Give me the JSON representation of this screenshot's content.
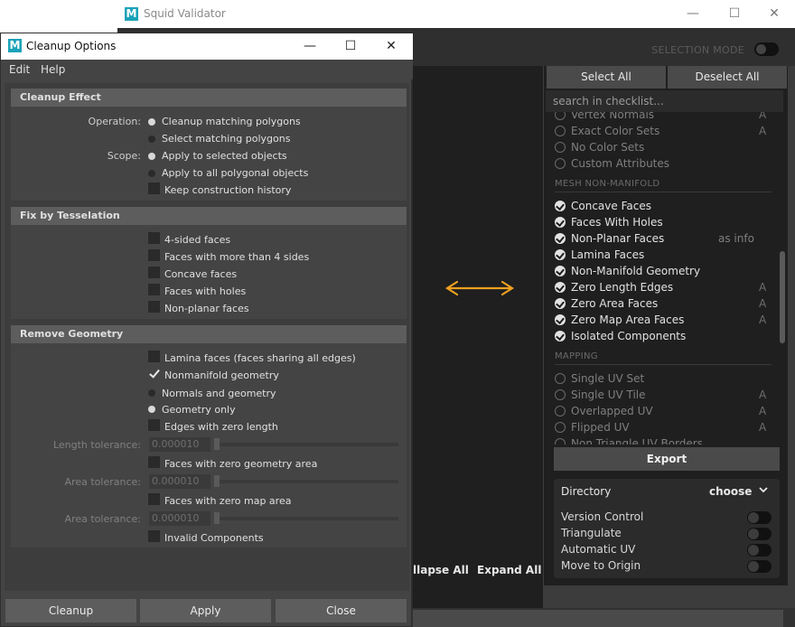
{
  "squid": {
    "title": "Squid Validator",
    "minimize": "—",
    "maximize": "☐",
    "close": "✕",
    "selection_mode": "SELECTION MODE",
    "select_all": "Select All",
    "deselect_all": "Deselect All",
    "search_placeholder": "search in checklist...",
    "collapse_all": "llapse All",
    "expand_all": "Expand All",
    "export": "Export",
    "directory_label": "Directory",
    "directory_value": "choose",
    "options": [
      "Version Control",
      "Triangulate",
      "Automatic UV",
      "Move to Origin"
    ],
    "arrow_color": "#f0a020",
    "sections": {
      "mesh_non_manifold": "MESH NON-MANIFOLD",
      "mapping": "MAPPING"
    },
    "items_top": [
      {
        "label": "Vertex Normals",
        "tag": "A",
        "on": false
      },
      {
        "label": "Exact Color Sets",
        "tag": "A",
        "on": false
      },
      {
        "label": "No Color Sets",
        "tag": "",
        "on": false
      },
      {
        "label": "Custom Attributes",
        "tag": "",
        "on": false
      }
    ],
    "items_manifold": [
      {
        "label": "Concave Faces",
        "tag": "",
        "on": true
      },
      {
        "label": "Faces With Holes",
        "tag": "",
        "on": true
      },
      {
        "label": "Non-Planar Faces",
        "tag": "",
        "info": "as info",
        "on": true
      },
      {
        "label": "Lamina Faces",
        "tag": "",
        "on": true
      },
      {
        "label": "Non-Manifold Geometry",
        "tag": "",
        "on": true
      },
      {
        "label": "Zero Length Edges",
        "tag": "A",
        "on": true
      },
      {
        "label": "Zero Area Faces",
        "tag": "A",
        "on": true
      },
      {
        "label": "Zero Map Area Faces",
        "tag": "A",
        "on": true
      },
      {
        "label": "Isolated Components",
        "tag": "",
        "on": true
      }
    ],
    "items_mapping": [
      {
        "label": "Single UV Set",
        "tag": "",
        "on": false
      },
      {
        "label": "Single UV Tile",
        "tag": "A",
        "on": false
      },
      {
        "label": "Overlapped UV",
        "tag": "A",
        "on": false
      },
      {
        "label": "Flipped UV",
        "tag": "A",
        "on": false
      },
      {
        "label": "Non Triangle UV Borders",
        "tag": "",
        "on": false
      }
    ]
  },
  "cleanup": {
    "title": "Cleanup Options",
    "minimize": "—",
    "maximize": "☐",
    "close": "✕",
    "menu": [
      "Edit",
      "Help"
    ],
    "effect": {
      "header": "Cleanup Effect",
      "operation_label": "Operation:",
      "op1": "Cleanup matching polygons",
      "op2": "Select matching polygons",
      "scope_label": "Scope:",
      "scope1": "Apply to selected objects",
      "scope2": "Apply to all polygonal objects",
      "history": "Keep construction history"
    },
    "tess": {
      "header": "Fix by Tesselation",
      "items": [
        "4-sided faces",
        "Faces with more than 4 sides",
        "Concave faces",
        "Faces with holes",
        "Non-planar faces"
      ]
    },
    "remove": {
      "header": "Remove Geometry",
      "lamina": "Lamina faces (faces sharing all edges)",
      "nonmanifold": "Nonmanifold geometry",
      "normals_geo": "Normals and geometry",
      "geo_only": "Geometry only",
      "zero_length": "Edges with zero length",
      "length_tol": "Length tolerance:",
      "length_val": "0.000010",
      "zero_geo_area": "Faces with zero geometry area",
      "area_tol": "Area tolerance:",
      "area_val": "0.000010",
      "zero_map_area": "Faces with zero map area",
      "area_tol2": "Area tolerance:",
      "area_val2": "0.000010",
      "invalid": "Invalid Components"
    },
    "buttons": {
      "cleanup": "Cleanup",
      "apply": "Apply",
      "close": "Close"
    }
  }
}
